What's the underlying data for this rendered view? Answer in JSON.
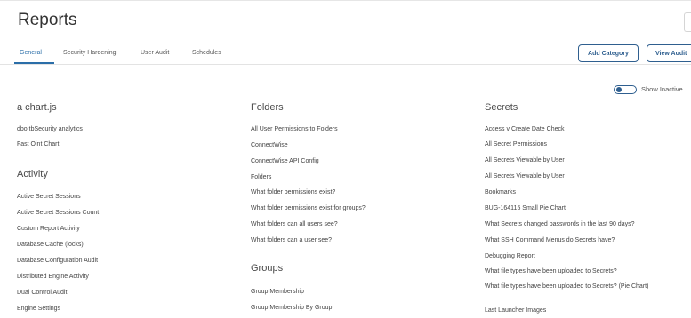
{
  "header": {
    "title": "Reports",
    "tabs": [
      {
        "label": "General",
        "active": true
      },
      {
        "label": "Security Hardening",
        "active": false
      },
      {
        "label": "User Audit",
        "active": false
      },
      {
        "label": "Schedules",
        "active": false
      }
    ],
    "buttons": {
      "add_category": "Add Category",
      "view_audit": "View Audit"
    }
  },
  "toggle": {
    "label": "Show Inactive",
    "on": false
  },
  "colors": {
    "accent": "#2b6ea8",
    "button_border": "#2f5f8f",
    "text": "#333333",
    "link": "#444444"
  },
  "columns": [
    {
      "sections": [
        {
          "title": "a chart.js",
          "items": [
            "dbo.tbSecurity analytics",
            "Fast Oint Chart"
          ]
        },
        {
          "title": "Activity",
          "items": [
            "Active Secret Sessions",
            "Active Secret Sessions Count",
            "Custom Report Activity",
            "Database Cache (locks)",
            "Database Configuration Audit",
            "Distributed Engine Activity",
            "Dual Control Audit",
            "Engine Settings"
          ]
        }
      ]
    },
    {
      "sections": [
        {
          "title": "Folders",
          "items": [
            "All User Permissions to Folders",
            "ConnectWise",
            "ConnectWise API Config",
            "Folders",
            "What folder permissions exist?",
            "What folder permissions exist for groups?",
            "What folders can all users see?",
            "What folders can a user see?"
          ]
        },
        {
          "title": "Groups",
          "items": [
            "Group Membership",
            "Group Membership By Group"
          ]
        }
      ]
    },
    {
      "sections": [
        {
          "title": "Secrets",
          "items": [
            "Access v Create Date Check",
            "All Secret Permissions",
            "All Secrets Viewable by User",
            "All Secrets Viewable by User",
            "Bookmarks",
            "BUG-164115 Small Pie Chart",
            "What Secrets changed passwords in the last 90 days?",
            "What SSH Command Menus do Secrets have?",
            "Debugging Report",
            "What file types have been uploaded to Secrets?",
            "What file types have been uploaded to Secrets? (Pie Chart)",
            "Last Launcher Images"
          ]
        }
      ]
    }
  ]
}
